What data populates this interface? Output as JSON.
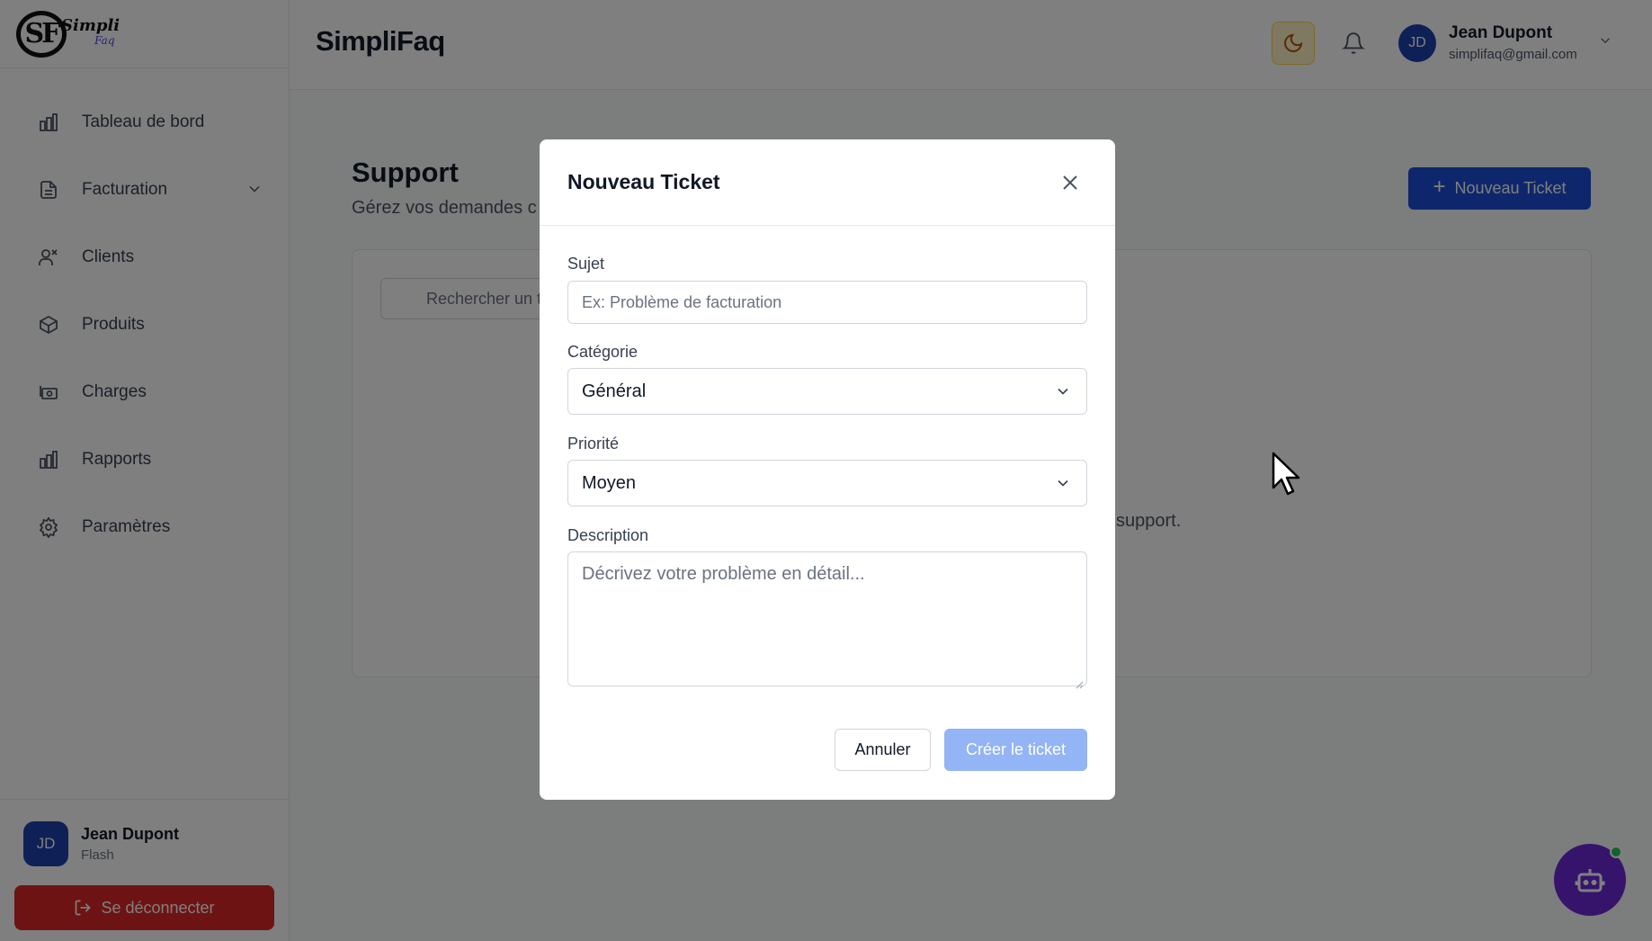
{
  "app": {
    "title": "SimpliFaq",
    "logo_text": "Simpli",
    "logo_sub": "Faq",
    "logo_mark": "SF"
  },
  "sidebar": {
    "items": [
      {
        "label": "Tableau de bord",
        "icon": "bar-chart-icon"
      },
      {
        "label": "Facturation",
        "icon": "file-text-icon",
        "has_submenu": true
      },
      {
        "label": "Clients",
        "icon": "users-icon"
      },
      {
        "label": "Produits",
        "icon": "box-icon"
      },
      {
        "label": "Charges",
        "icon": "wallet-icon"
      },
      {
        "label": "Rapports",
        "icon": "bar-chart-icon"
      },
      {
        "label": "Paramètres",
        "icon": "gear-icon"
      }
    ],
    "user": {
      "initials": "JD",
      "name": "Jean Dupont",
      "plan": "Flash"
    },
    "logout_label": "Se déconnecter"
  },
  "header": {
    "user": {
      "initials": "JD",
      "name": "Jean Dupont",
      "email": "simplifaq@gmail.com"
    }
  },
  "main": {
    "title": "Support",
    "subtitle": "Gérez vos demandes c",
    "new_ticket_label": "Nouveau Ticket",
    "search_placeholder": "Rechercher un t",
    "empty_text": "support."
  },
  "modal": {
    "title": "Nouveau Ticket",
    "fields": {
      "subject": {
        "label": "Sujet",
        "placeholder": "Ex: Problème de facturation"
      },
      "category": {
        "label": "Catégorie",
        "value": "Général"
      },
      "priority": {
        "label": "Priorité",
        "value": "Moyen"
      },
      "description": {
        "label": "Description",
        "placeholder": "Décrivez votre problème en détail..."
      }
    },
    "cancel_label": "Annuler",
    "create_label": "Créer le ticket"
  },
  "colors": {
    "primary": "#1d4ed8",
    "danger": "#dc2626",
    "bot": "#6d28d9",
    "disabled_button": "#93b4f5"
  }
}
